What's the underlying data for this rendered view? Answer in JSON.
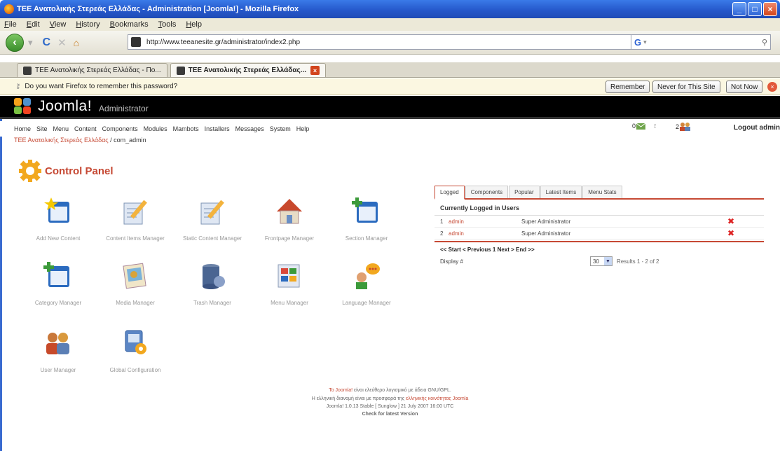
{
  "window": {
    "title": "ΤΕΕ Ανατολικής Στερεάς Ελλάδας - Administration [Joomla!] - Mozilla Firefox",
    "buttons": [
      "_",
      "□",
      "×"
    ]
  },
  "menubar": [
    "File",
    "Edit",
    "View",
    "History",
    "Bookmarks",
    "Tools",
    "Help"
  ],
  "navigation": {
    "url": "http://www.teeanesite.gr/administrator/index2.php",
    "search_placeholder": ""
  },
  "tabs": [
    {
      "label": "ΤΕΕ Ανατολικής Στερεάς Ελλάδας - Πο...",
      "active": false
    },
    {
      "label": "ΤΕΕ Ανατολικής Στερεάς Ελλάδας...",
      "active": true
    }
  ],
  "password_bar": {
    "message": "Do you want Firefox to remember this password?",
    "remember": "Remember",
    "never": "Never for This Site",
    "not_now": "Not Now"
  },
  "joomla": {
    "logo": "Joomla!",
    "admin_label": "Administrator",
    "menu": [
      "Home",
      "Site",
      "Menu",
      "Content",
      "Components",
      "Modules",
      "Mambots",
      "Installers",
      "Messages",
      "System",
      "Help"
    ],
    "status": {
      "messages": "0",
      "users": "2"
    },
    "logout": "Logout admin",
    "pathway": {
      "site": "ΤΕΕ Ανατολικής Στερεάς Ελλάδας",
      "current": " / com_admin"
    },
    "page_title": "Control Panel",
    "quick_icons": [
      {
        "label": "Add New Content",
        "icon": "add-content-icon"
      },
      {
        "label": "Content Items Manager",
        "icon": "content-items-icon"
      },
      {
        "label": "Static Content Manager",
        "icon": "static-content-icon"
      },
      {
        "label": "Frontpage Manager",
        "icon": "frontpage-icon"
      },
      {
        "label": "Section Manager",
        "icon": "section-icon"
      },
      {
        "label": "Category Manager",
        "icon": "category-icon"
      },
      {
        "label": "Media Manager",
        "icon": "media-icon"
      },
      {
        "label": "Trash Manager",
        "icon": "trash-icon"
      },
      {
        "label": "Menu Manager",
        "icon": "menu-icon"
      },
      {
        "label": "Language Manager",
        "icon": "language-icon"
      },
      {
        "label": "User Manager",
        "icon": "users-icon"
      },
      {
        "label": "Global Configuration",
        "icon": "config-icon"
      }
    ],
    "panel": {
      "tabs": [
        "Logged",
        "Components",
        "Popular",
        "Latest Items",
        "Menu Stats"
      ],
      "title": "Currently Logged in Users",
      "rows": [
        {
          "n": "1",
          "name": "admin",
          "role": "Super Administrator"
        },
        {
          "n": "2",
          "name": "admin",
          "role": "Super Administrator"
        }
      ],
      "pager": "<< Start < Previous 1 Next > End >>",
      "display_label": "Display #",
      "display_value": "30",
      "results": "Results 1 - 2 of 2"
    },
    "footer": {
      "line1_link": "Το Joomla!",
      "line1_text": " είναι ελεύθερο λογισμικό με άδεια GNU/GPL.",
      "line2_text": "Η ελληνική διανομή είναι με προσφορά της ",
      "line2_link": "ελληνικής κοινότητας Joomla",
      "line3": "Joomla! 1.0.13 Stable [ Sunglow ] 21 July 2007 16:00 UTC",
      "line4": "Check for latest Version"
    }
  },
  "colors": {
    "joomla_red": "#c64934",
    "header_black": "#000000",
    "titlebar_blue": "#2456c9"
  }
}
